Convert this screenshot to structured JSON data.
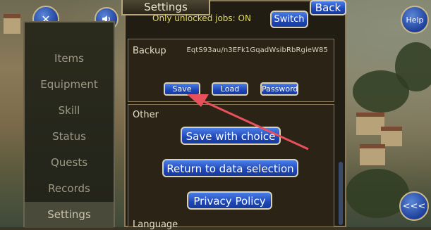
{
  "header": {
    "title": "Settings",
    "back_label": "Back",
    "help_label": "Help"
  },
  "sidebar": {
    "items": [
      {
        "label": "Items"
      },
      {
        "label": "Equipment"
      },
      {
        "label": "Skill"
      },
      {
        "label": "Status"
      },
      {
        "label": "Quests"
      },
      {
        "label": "Records"
      },
      {
        "label": "Settings"
      }
    ]
  },
  "jobs": {
    "label": "Only unlocked jobs: ON",
    "switch_label": "Switch"
  },
  "backup": {
    "label": "Backup",
    "code": "EqtS93au/n3EFk1GqadWsibRbRgieW85",
    "save_label": "Save",
    "load_label": "Load",
    "password_label": "Password"
  },
  "other": {
    "label": "Other",
    "save_choice_label": "Save with choice",
    "return_label": "Return to data selection",
    "privacy_label": "Privacy Policy"
  },
  "language": {
    "label": "Language"
  },
  "colors": {
    "button_blue": "#1f47b8",
    "annotation_arrow": "#e8505b",
    "jobs_text": "#e2dc60"
  }
}
